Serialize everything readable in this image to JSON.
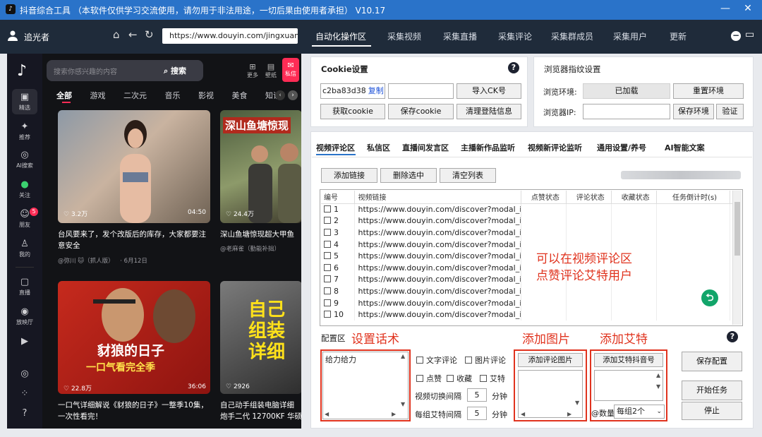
{
  "titlebar": {
    "title": "抖音综合工具 （本软件仅供学习交流使用，请勿用于非法用途，一切后果由使用者承担） V10.17"
  },
  "navbar": {
    "user": "追光者",
    "url": "https://www.douyin.com/jingxuan",
    "tabs": [
      "自动化操作区",
      "采集视频",
      "采集直播",
      "采集评论",
      "采集群成员",
      "采集用户",
      "更新"
    ]
  },
  "douyin": {
    "search_placeholder": "搜索你感兴趣的内容",
    "search_btn": "搜索",
    "top_icons": [
      "更多",
      "壁纸",
      "私信"
    ],
    "categories": [
      "全部",
      "游戏",
      "二次元",
      "音乐",
      "影视",
      "美食",
      "知识"
    ],
    "side": [
      "精选",
      "推荐",
      "AI搜索",
      "关注",
      "朋友",
      "我的",
      "直播",
      "放映厅",
      "",
      "",
      ""
    ],
    "friends_badge": "5",
    "cards": [
      {
        "likes": "3.2万",
        "duration": "04:50",
        "title": "台风要来了，发个改版后的库存，大家都要注意安全",
        "author": "@弥川 🐱（抓人版）",
        "date": "· 6月12日"
      },
      {
        "overlay": "深山鱼塘惊现",
        "likes": "24.4万",
        "title": "深山鱼塘惊现超大甲鱼",
        "author": "@老麻雀（勤能补拙）"
      },
      {
        "overlay1": "豺狼的日子",
        "overlay2": "一口气看完全季",
        "likes": "22.8万",
        "duration": "36:06",
        "title": "一口气详细解说《豺狼的日子》一整季10集，一次性看完！"
      },
      {
        "overlay": "自己组装详细",
        "likes": "2926",
        "title": "自己动手组装电脑详细",
        "title2": "炮手二代 12700KF 华硕"
      }
    ]
  },
  "cookie": {
    "title": "Cookie设置",
    "value": "c2ba83d38",
    "copy": "复制",
    "import_btn": "导入CK号",
    "get_btn": "获取cookie",
    "save_btn": "保存cookie",
    "clear_btn": "清理登陆信息"
  },
  "fingerprint": {
    "title": "浏览器指纹设置",
    "env_label": "浏览环境:",
    "env_value": "已加载",
    "reset_btn": "重置环境",
    "ip_label": "浏览器IP:",
    "save_btn": "保存环境",
    "verify_btn": "验证"
  },
  "func_tabs": [
    "视频评论区",
    "私信区",
    "直播间发言区",
    "主播新作品监听",
    "视频新评论监听",
    "通用设置/养号",
    "AI智能文案"
  ],
  "list": {
    "add_btn": "添加链接",
    "del_btn": "删除选中",
    "clear_btn": "清空列表",
    "headers": [
      "编号",
      "视频链接",
      "点赞状态",
      "评论状态",
      "收藏状态",
      "任务倒计时(s)"
    ],
    "rows": [
      {
        "no": "1",
        "url": "https://www.douyin.com/discover?modal_id"
      },
      {
        "no": "2",
        "url": "https://www.douyin.com/discover?modal_id"
      },
      {
        "no": "3",
        "url": "https://www.douyin.com/discover?modal_id"
      },
      {
        "no": "4",
        "url": "https://www.douyin.com/discover?modal_id"
      },
      {
        "no": "5",
        "url": "https://www.douyin.com/discover?modal_id"
      },
      {
        "no": "6",
        "url": "https://www.douyin.com/discover?modal_id"
      },
      {
        "no": "7",
        "url": "https://www.douyin.com/discover?modal_id"
      },
      {
        "no": "8",
        "url": "https://www.douyin.com/discover?modal_id"
      },
      {
        "no": "9",
        "url": "https://www.douyin.com/discover?modal_id"
      },
      {
        "no": "10",
        "url": "https://www.douyin.com/discover?modal_id"
      }
    ]
  },
  "annotations": {
    "list_note1": "可以在视频评论区",
    "list_note2": "点赞评论艾特用户",
    "script": "设置话术",
    "image": "添加图片",
    "mention": "添加艾特"
  },
  "config": {
    "title": "配置区",
    "script_text": "给力给力",
    "cb_text": "文字评论",
    "cb_image": "图片评论",
    "cb_like": "点赞",
    "cb_fav": "收藏",
    "cb_at": "艾特",
    "switch_label": "视频切换间隔",
    "switch_value": "5",
    "switch_unit": "分钟",
    "group_label": "每组艾特间隔",
    "group_value": "5",
    "group_unit": "分钟",
    "add_image_btn": "添加评论图片",
    "add_mention_btn": "添加艾特抖音号",
    "count_label": "@数量",
    "count_value": "每组2个",
    "save_btn": "保存配置",
    "start_btn": "开始任务",
    "stop_btn": "停止"
  }
}
